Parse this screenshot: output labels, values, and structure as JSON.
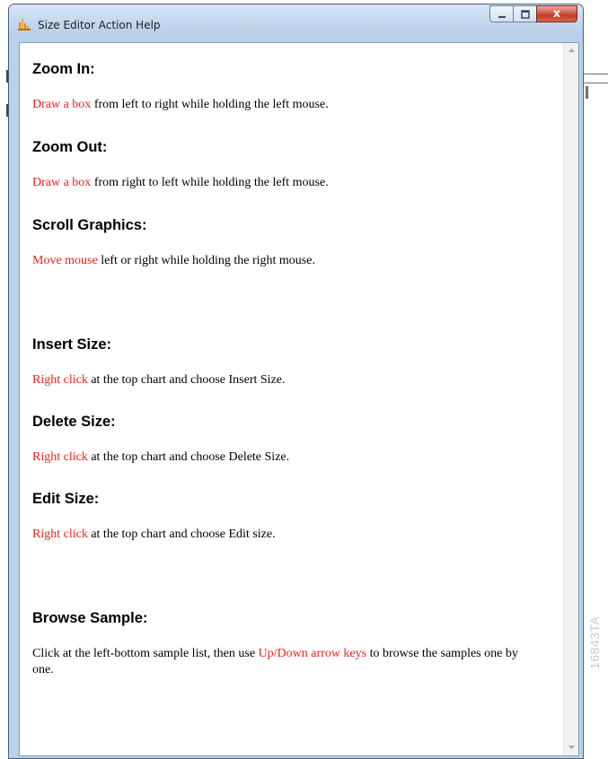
{
  "window": {
    "title": "Size Editor Action Help",
    "icons": {
      "app": "chart-app-icon",
      "minimize": "minimize-icon",
      "maximize": "maximize-icon",
      "close": "close-icon"
    },
    "close_glyph": "x"
  },
  "sections": [
    {
      "heading": "Zoom In:",
      "highlight": "Draw a box",
      "text": " from left to right while holding the left mouse.",
      "after": ""
    },
    {
      "heading": "Zoom Out:",
      "highlight": "Draw a box",
      "text": " from right to left while holding the left mouse.",
      "after": ""
    },
    {
      "heading": "Scroll Graphics:",
      "highlight": "Move mouse",
      "text": " left or right while holding the right mouse.",
      "after": ""
    },
    {
      "heading": "Insert Size:",
      "highlight": "Right click",
      "text": " at the top chart and choose Insert Size.",
      "after": ""
    },
    {
      "heading": "Delete Size:",
      "highlight": "Right click",
      "text": " at the top chart and choose Delete Size.",
      "after": ""
    },
    {
      "heading": "Edit Size:",
      "highlight": "Right click",
      "text": " at the top chart and choose Edit size.",
      "after": ""
    },
    {
      "heading": "Browse Sample:",
      "before": "Click at the left-bottom sample list, then use ",
      "highlight": "Up/Down arrow keys",
      "after": " to browse the samples one by one."
    }
  ],
  "colors": {
    "highlight": "#e8231d",
    "close_button": "#c03b26",
    "titlebar": "#c4d8ef"
  },
  "watermark": "16843TA"
}
